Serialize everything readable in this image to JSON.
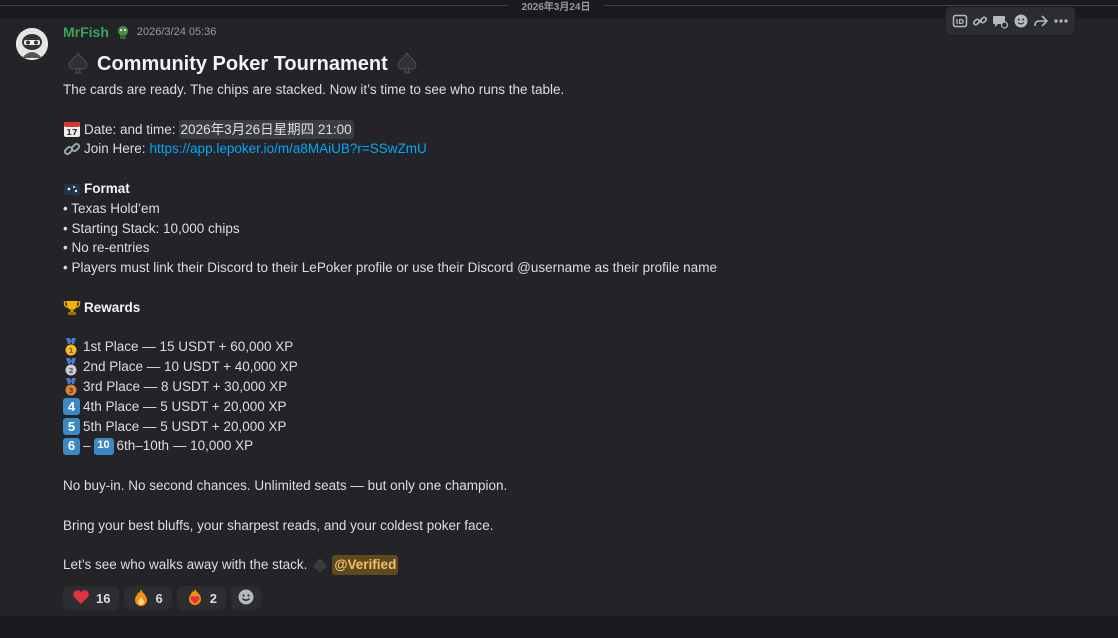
{
  "divider": {
    "date": "2026年3月24日"
  },
  "author": {
    "name": "MrFish",
    "timestamp": "2026/3/24 05:36"
  },
  "toolbar": {
    "icons": [
      "id-icon",
      "link-icon",
      "add-reaction-icon",
      "emoji-icon",
      "forward-icon",
      "more-icon"
    ]
  },
  "message": {
    "title": "Community Poker Tournament",
    "intro": "The cards are ready. The chips are stacked. Now it’s time to see who runs the table.",
    "date_label": "Date: and time:",
    "date_value": "2026年3月26日星期四 21:00",
    "join_label": "Join Here:",
    "join_url": "https://app.lepoker.io/m/a8MAiUB?r=SSwZmU",
    "format_heading": "Format",
    "format_items": [
      "• Texas Hold’em",
      "• Starting Stack: 10,000 chips",
      "• No re-entries",
      "• Players must link their Discord to their LePoker profile or use their Discord @username as their profile name"
    ],
    "rewards_heading": "Rewards",
    "rewards": [
      {
        "icon": "1st-place-medal",
        "text": "1st Place — 15 USDT + 60,000 XP"
      },
      {
        "icon": "2nd-place-medal",
        "text": "2nd Place — 10 USDT + 40,000 XP"
      },
      {
        "icon": "3rd-place-medal",
        "text": "3rd Place — 8 USDT + 30,000 XP"
      },
      {
        "icon": "keycap-4",
        "keycap": "4",
        "text": "4th Place — 5 USDT + 20,000 XP"
      },
      {
        "icon": "keycap-5",
        "keycap": "5",
        "text": "5th Place — 5 USDT + 20,000 XP"
      }
    ],
    "reward_last": {
      "key_a": "6",
      "dash": "–",
      "key_b": "10",
      "text": "6th–10th — 10,000 XP"
    },
    "line_buyin": "No buy-in. No second chances. Unlimited seats — but only one champion.",
    "line_bluffs": "Bring your best bluffs, your sharpest reads, and your coldest poker face.",
    "line_final": "Let’s see who walks away with the stack.",
    "mention": "@Verified"
  },
  "reactions": [
    {
      "emoji": "heart",
      "count": "16"
    },
    {
      "emoji": "fire",
      "count": "6"
    },
    {
      "emoji": "heart-on-fire",
      "count": "2"
    }
  ],
  "colors": {
    "username": "#3ba55c",
    "link": "#00a8fc",
    "mention_bg": "#5e4a1f",
    "background": "#242428"
  }
}
